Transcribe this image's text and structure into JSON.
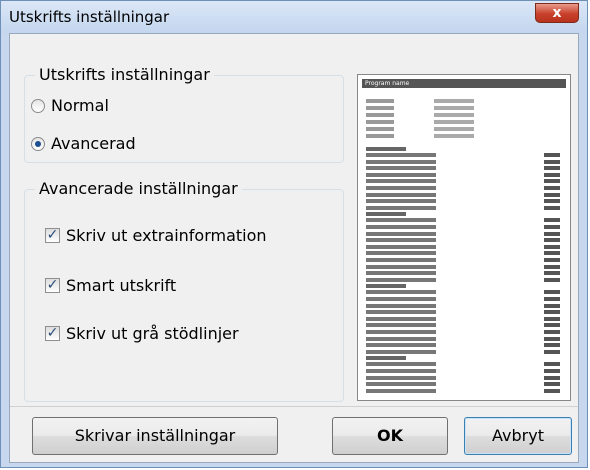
{
  "window": {
    "title": "Utskrifts inställningar",
    "close_glyph": "x"
  },
  "print_settings": {
    "legend": "Utskrifts inställningar",
    "options": [
      {
        "label": "Normal",
        "selected": false
      },
      {
        "label": "Avancerad",
        "selected": true
      }
    ]
  },
  "advanced": {
    "legend": "Avancerade inställningar",
    "options": [
      {
        "label": "Skriv ut extrainformation",
        "checked": true
      },
      {
        "label": "Smart utskrift",
        "checked": true
      },
      {
        "label": "Skriv ut grå stödlinjer",
        "checked": true
      }
    ]
  },
  "preview": {
    "header": "Program name"
  },
  "buttons": {
    "printer_settings": "Skrivar inställningar",
    "ok": "OK",
    "cancel": "Avbryt"
  },
  "colors": {
    "titlebar": "#c7d8ee",
    "close": "#c8402a",
    "dialog": "#f0f0f0"
  }
}
